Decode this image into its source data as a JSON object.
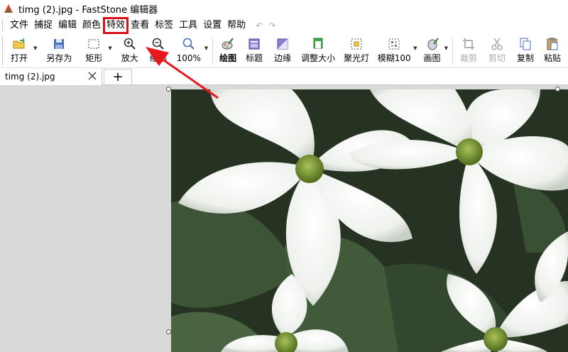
{
  "window": {
    "title": "timg (2).jpg - FastStone 编辑器"
  },
  "menu": {
    "items": [
      "文件",
      "捕捉",
      "编辑",
      "颜色",
      "特效",
      "查看",
      "标签",
      "工具",
      "设置",
      "帮助"
    ],
    "highlighted": "特效"
  },
  "toolbar": {
    "open": "打开",
    "save_as": "另存为",
    "rect": "矩形",
    "zoom_in": "放大",
    "zoom_out": "缩小",
    "zoom_level": "100%",
    "draw": "绘图",
    "caption": "标题",
    "edge": "边缘",
    "resize": "调整大小",
    "spotlight": "聚光灯",
    "blur": "模糊100",
    "canvas": "画图",
    "crop": "裁剪",
    "cut": "剪切",
    "copy": "复制",
    "paste": "粘贴"
  },
  "tabs": {
    "active": "timg (2).jpg",
    "add": "+"
  },
  "colors": {
    "highlight": "#d9111b",
    "arrow": "#e8171c",
    "canvas_bg": "#d9d9d9"
  },
  "icons": {
    "open": "folder-open-icon",
    "save": "floppy-disk-icon",
    "rect": "dashed-rectangle-icon",
    "zoom_in": "magnifier-plus-icon",
    "zoom_out": "magnifier-minus-icon",
    "zoom": "magnifier-icon",
    "draw": "palette-brush-icon",
    "caption": "caption-window-icon",
    "edge": "edge-frame-icon",
    "resize": "resize-icon",
    "spotlight": "spotlight-frame-icon",
    "blur": "blur-grid-icon",
    "canvas": "paint-canvas-icon",
    "crop": "crop-icon",
    "cut": "scissors-icon",
    "copy": "copy-pages-icon",
    "paste": "clipboard-icon",
    "close": "close-icon",
    "undo": "undo-arrow-icon",
    "redo": "redo-arrow-icon"
  }
}
